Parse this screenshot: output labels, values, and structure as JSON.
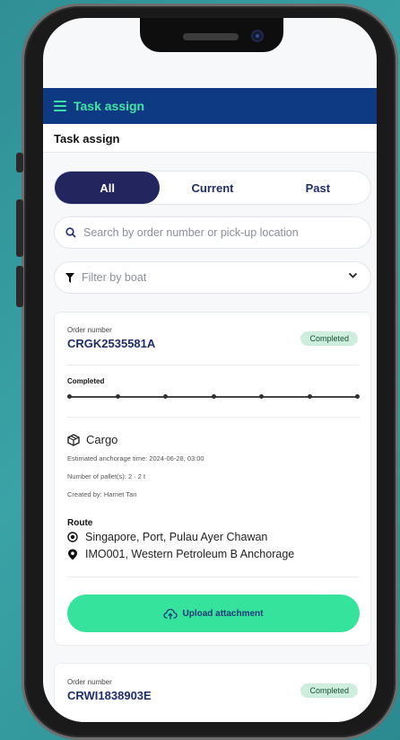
{
  "header": {
    "menu_title": "Task assign",
    "page_title": "Task assign"
  },
  "tabs": [
    {
      "label": "All",
      "active": true
    },
    {
      "label": "Current",
      "active": false
    },
    {
      "label": "Past",
      "active": false
    }
  ],
  "search": {
    "placeholder": "Search by order number or pick-up location",
    "value": ""
  },
  "filter": {
    "placeholder": "Filter by boat",
    "selected": ""
  },
  "orders": [
    {
      "order_number_label": "Order number",
      "order_number": "CRGK2535581A",
      "status": "Completed",
      "progress_label": "Completed",
      "progress_steps_total": 7,
      "progress_steps_done": 7,
      "cargo_type": "Cargo",
      "anchorage_time": "Estimated anchorage time: 2024-06-28, 03:00",
      "pallets": "Number of pallet(s): 2 · 2 t",
      "created_by": "Created by: Harriet Tan",
      "route_label": "Route",
      "route_from": "Singapore, Port, Pulau Ayer Chawan",
      "route_to": "IMO001, Western Petroleum B Anchorage",
      "upload_label": "Upload attachment"
    },
    {
      "order_number_label": "Order number",
      "order_number": "CRWI1838903E",
      "status": "Completed"
    }
  ],
  "colors": {
    "navbar": "#0d3a82",
    "accent": "#3ee6a6",
    "active_tab": "#23255f",
    "upload_button": "#36e39c",
    "badge_bg": "#cdeedd"
  }
}
